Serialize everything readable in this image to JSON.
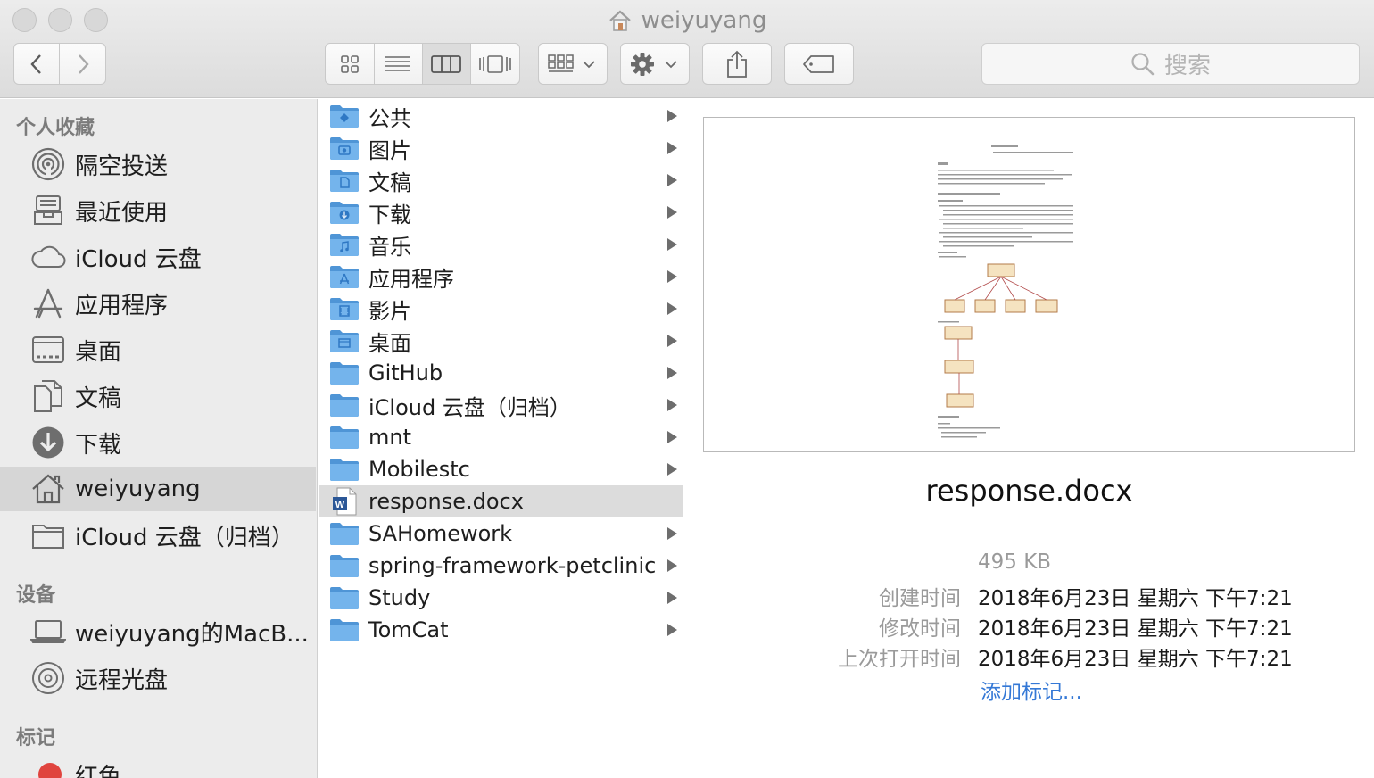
{
  "window": {
    "title": "weiyuyang"
  },
  "toolbar": {
    "back_icon": "chevron-left-icon",
    "forward_icon": "chevron-right-icon",
    "view_modes": [
      "icon-view",
      "list-view",
      "column-view",
      "cover-flow-view"
    ],
    "active_view": "column-view",
    "search_placeholder": "搜索"
  },
  "sidebar": {
    "favorites_header": "个人收藏",
    "favorites": [
      {
        "label": "隔空投送",
        "icon": "airdrop-icon"
      },
      {
        "label": "最近使用",
        "icon": "recents-icon"
      },
      {
        "label": "iCloud 云盘",
        "icon": "icloud-icon"
      },
      {
        "label": "应用程序",
        "icon": "applications-icon"
      },
      {
        "label": "桌面",
        "icon": "desktop-icon"
      },
      {
        "label": "文稿",
        "icon": "documents-icon"
      },
      {
        "label": "下载",
        "icon": "downloads-icon"
      },
      {
        "label": "weiyuyang",
        "icon": "home-icon",
        "selected": true
      },
      {
        "label": "iCloud 云盘（归档）",
        "icon": "folder-icon"
      }
    ],
    "devices_header": "设备",
    "devices": [
      {
        "label": "weiyuyang的MacB...",
        "icon": "laptop-icon"
      },
      {
        "label": "远程光盘",
        "icon": "disc-icon"
      }
    ],
    "tags_header": "标记",
    "tags": [
      {
        "label": "红色",
        "color": "#e0443e"
      }
    ]
  },
  "column": {
    "items": [
      {
        "label": "公共",
        "icon": "public-folder-icon",
        "arrow": true
      },
      {
        "label": "图片",
        "icon": "pictures-folder-icon",
        "arrow": true
      },
      {
        "label": "文稿",
        "icon": "documents-folder-icon",
        "arrow": true
      },
      {
        "label": "下载",
        "icon": "downloads-folder-icon",
        "arrow": true
      },
      {
        "label": "音乐",
        "icon": "music-folder-icon",
        "arrow": true
      },
      {
        "label": "应用程序",
        "icon": "applications-folder-icon",
        "arrow": true
      },
      {
        "label": "影片",
        "icon": "movies-folder-icon",
        "arrow": true
      },
      {
        "label": "桌面",
        "icon": "desktop-folder-icon",
        "arrow": true
      },
      {
        "label": "GitHub",
        "icon": "folder-icon",
        "arrow": true
      },
      {
        "label": "iCloud 云盘（归档）",
        "icon": "folder-icon",
        "arrow": true
      },
      {
        "label": "mnt",
        "icon": "folder-icon",
        "arrow": true
      },
      {
        "label": "Mobilestc",
        "icon": "folder-icon",
        "arrow": true
      },
      {
        "label": "response.docx",
        "icon": "word-document-icon",
        "arrow": false,
        "selected": true
      },
      {
        "label": "SAHomework",
        "icon": "folder-icon",
        "arrow": true
      },
      {
        "label": "spring-framework-petclinic",
        "icon": "folder-icon",
        "arrow": true
      },
      {
        "label": "Study",
        "icon": "folder-icon",
        "arrow": true
      },
      {
        "label": "TomCat",
        "icon": "folder-icon",
        "arrow": true
      }
    ]
  },
  "preview": {
    "filename": "response.docx",
    "size": "495 KB",
    "created_label": "创建时间",
    "created_value": "2018年6月23日 星期六 下午7:21",
    "modified_label": "修改时间",
    "modified_value": "2018年6月23日 星期六 下午7:21",
    "opened_label": "上次打开时间",
    "opened_value": "2018年6月23日 星期六 下午7:21",
    "add_tags": "添加标记..."
  },
  "colors": {
    "folder": "#6aaee8",
    "folder_dark": "#4f95d6",
    "selection": "#d6d6d6",
    "link": "#3478d6"
  }
}
